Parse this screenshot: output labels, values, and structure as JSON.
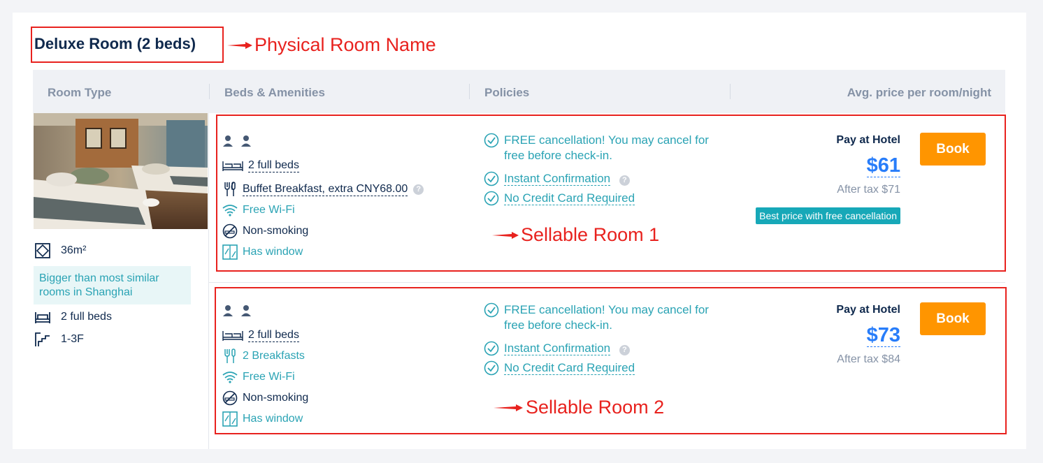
{
  "room": {
    "name": "Deluxe Room (2 beds)",
    "size": "36m²",
    "size_note": "Bigger than most similar rooms in Shanghai",
    "beds": "2 full beds",
    "floor": "1-3F"
  },
  "annotations": {
    "physical_room": "Physical Room Name",
    "sellable_1": "Sellable Room 1",
    "sellable_2": "Sellable Room 2"
  },
  "table_headers": [
    "Room Type",
    "Beds & Amenities",
    "Policies",
    "Avg. price per room/night"
  ],
  "offers": [
    {
      "beds": "2 full beds",
      "breakfast": "Buffet Breakfast, extra CNY68.00",
      "wifi": "Free Wi-Fi",
      "smoking": "Non-smoking",
      "window": "Has window",
      "policy_cancel": "FREE cancellation! You may cancel for free before check-in.",
      "policy_confirm": "Instant Confirmation",
      "policy_card": "No Credit Card Required",
      "pay_label": "Pay at Hotel",
      "price": "$61",
      "after_tax": "After tax $71",
      "badge": "Best price with free cancellation",
      "book_label": "Book"
    },
    {
      "beds": "2 full beds",
      "breakfast": "2 Breakfasts",
      "wifi": "Free Wi-Fi",
      "smoking": "Non-smoking",
      "window": "Has window",
      "policy_cancel": "FREE cancellation! You may cancel for free before check-in.",
      "policy_confirm": "Instant Confirmation",
      "policy_card": "No Credit Card Required",
      "pay_label": "Pay at Hotel",
      "price": "$73",
      "after_tax": "After tax $84",
      "book_label": "Book"
    }
  ],
  "colors": {
    "annotation_red": "#e8221e",
    "teal": "#2aa3b4",
    "price_blue": "#287dfa",
    "book_orange": "#ff9500",
    "navy": "#0f294d"
  }
}
